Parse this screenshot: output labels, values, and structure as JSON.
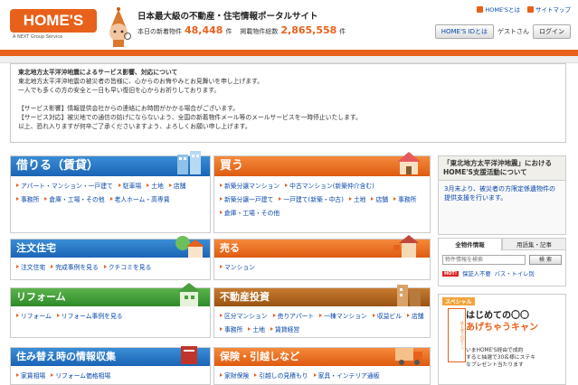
{
  "header": {
    "logo": "HOME'S",
    "logo_sub": "A NEXT Group Service",
    "tagline": "日本最大級の不動産・住宅情報ポータルサイト",
    "stats": {
      "new_label": "本日の新着物件",
      "new_count": "48,448",
      "new_unit": "件",
      "total_label": "掲載物件総数",
      "total_count": "2,865,558",
      "total_unit": "件"
    },
    "toplinks": [
      "HOME'Sとは",
      "サイトマップ"
    ],
    "userbar": {
      "id_link": "HOME'S IDとは",
      "guest": "ゲストさん",
      "login": "ログイン"
    }
  },
  "notice": {
    "title": "東北地方太平洋沖地震によるサービス影響、対応について",
    "lines": [
      "東北地方太平洋沖地震の被災者の皆様に、心からのお悔やみとお見舞いを申し上げます。",
      "一人でも多くの方の安全と一日も早い復旧を心からお祈りしております。",
      "",
      "【サービス影響】情報提供会社からの連絡にお時間がかかる場合がございます。",
      "【サービス対応】被災地での通信の妨げにならないよう、全国の新着物件メール等のメールサービスを一時停止いたします。",
      "以上、恐れ入りますが何卒ご了承くださいますよう、よろしくお願い申し上げます。"
    ]
  },
  "panels": {
    "rent": {
      "title": "借りる（賃貸）",
      "links": [
        "アパート・マンション・一戸建て",
        "駐車場",
        "土地",
        "店舗",
        "事務所",
        "倉庫・工場・その他",
        "老人ホーム・高専賃"
      ]
    },
    "buy": {
      "title": "買う",
      "links": [
        "新築分譲マンション",
        "中古マンション(新築仲介含む)",
        "新築分譲一戸建て",
        "一戸建て(新築・中古)",
        "土地",
        "店舗",
        "事務所",
        "倉庫・工場・その他"
      ]
    },
    "order": {
      "title": "注文住宅",
      "links": [
        "注文住宅",
        "完成事例を見る",
        "クチコミを見る"
      ]
    },
    "sell": {
      "title": "売る",
      "links": [
        "マンション"
      ]
    },
    "reform": {
      "title": "リフォーム",
      "links": [
        "リフォーム",
        "リフォーム事例を見る"
      ]
    },
    "invest": {
      "title": "不動産投資",
      "links": [
        "区分マンション",
        "売りアパート",
        "一棟マンション",
        "収益ビル",
        "店舗",
        "事務所",
        "土地",
        "賃貸経営"
      ]
    },
    "move": {
      "title": "住み替え時の情報収集",
      "links": [
        "家賃相場",
        "リフォーム価格相場"
      ]
    },
    "insurance": {
      "title": "保険・引越しなど",
      "links": [
        "家財保険",
        "引越しの見積もり",
        "家具・インテリア通販"
      ]
    }
  },
  "sidebar": {
    "support_title": "「東北地方太平洋沖地震」における HOME'S支援活動について",
    "support_body": "3月末より、被災者の方限定係遺物件の提供支援を行います。",
    "tabs": [
      "全物件情報",
      "用語集・記事"
    ],
    "search_placeholder": "物件情報を検索",
    "search_button": "検 索",
    "hot_badge": "HOT!",
    "hot_links": [
      "保証人不要",
      "バス・トイレ別"
    ],
    "ad": {
      "badge": "スペシャル",
      "headline_1": "はじめての〇〇",
      "headline_2": "あげちゃうキャン",
      "sub_1": "いまHOME'S経由で成約",
      "sub_2": "すると抽選で30名様にステキ",
      "sub_3": "なプレゼント当たります",
      "side_label": "はじめてのピーン"
    }
  }
}
